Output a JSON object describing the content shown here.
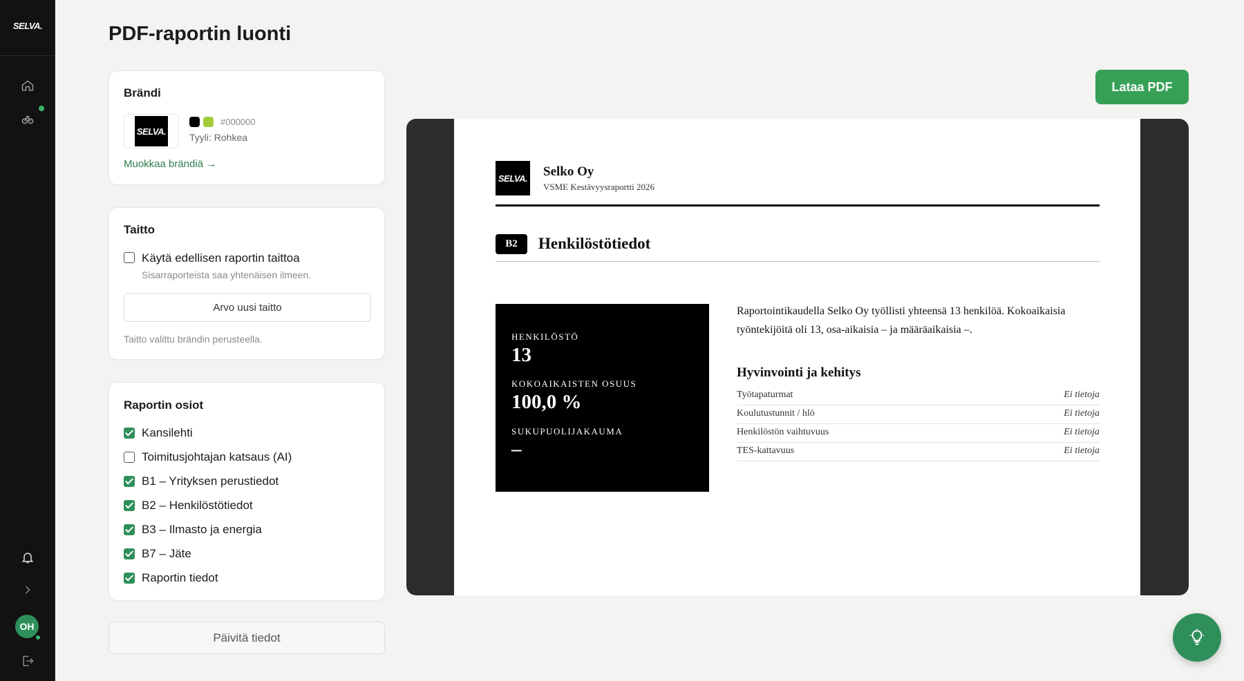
{
  "sidebar": {
    "logo_text": "SELVA.",
    "avatar_initials": "OH",
    "icons": [
      "home-icon",
      "cycle-icon",
      "bell-icon",
      "chevron-right-icon",
      "logout-icon"
    ]
  },
  "page": {
    "title": "PDF-raportin luonti"
  },
  "brand_card": {
    "title": "Brändi",
    "logo_text": "SELVA.",
    "swatches": [
      "#000000",
      "#a3cc3b"
    ],
    "hex": "#000000",
    "style": "Tyyli: Rohkea",
    "edit_link": "Muokkaa brändiä →"
  },
  "layout_card": {
    "title": "Taitto",
    "checkbox_label": "Käytä edellisen raportin taittoa",
    "checkbox_checked": false,
    "checkbox_hint": "Sisarraporteista saa yhtenäisen ilmeen.",
    "random_button": "Arvo uusi taitto",
    "footnote": "Taitto valittu brändin perusteella."
  },
  "sections_card": {
    "title": "Raportin osiot",
    "items": [
      {
        "label": "Kansilehti",
        "checked": true
      },
      {
        "label": "Toimitusjohtajan katsaus (AI)",
        "checked": false
      },
      {
        "label": "B1 – Yrityksen perustiedot",
        "checked": true
      },
      {
        "label": "B2 – Henkilöstötiedot",
        "checked": true
      },
      {
        "label": "B3 – Ilmasto ja energia",
        "checked": true
      },
      {
        "label": "B7 – Jäte",
        "checked": true
      },
      {
        "label": "Raportin tiedot",
        "checked": true
      }
    ]
  },
  "update_button": "Päivitä tiedot",
  "download_button": "Lataa PDF",
  "preview": {
    "logo_text": "SELVA.",
    "company": "Selko Oy",
    "report_name": "VSME Kestävyysraportti 2026",
    "badge": "B2",
    "section_title": "Henkilöstötiedot",
    "stats": [
      {
        "label": "HENKILÖSTÖ",
        "value": "13"
      },
      {
        "label": "KOKOAIKAISTEN OSUUS",
        "value": "100,0 %"
      },
      {
        "label": "SUKUPUOLIJAKAUMA",
        "value": "–"
      }
    ],
    "paragraph": "Raportointikaudella Selko Oy työllisti yhteensä 13 henkilöä. Kokoaikaisia työntekijöitä oli 13, osa-aikaisia – ja määräaikaisia –.",
    "sub_heading": "Hyvinvointi ja kehitys",
    "rows": [
      {
        "key": "Työtapaturmat",
        "value": "Ei tietoja"
      },
      {
        "key": "Koulutustunnit / hlö",
        "value": "Ei tietoja"
      },
      {
        "key": "Henkilöstön vaihtuvuus",
        "value": "Ei tietoja"
      },
      {
        "key": "TES-kattavuus",
        "value": "Ei tietoja"
      }
    ]
  },
  "colors": {
    "accent": "#36a057",
    "sidebar": "#121212"
  }
}
